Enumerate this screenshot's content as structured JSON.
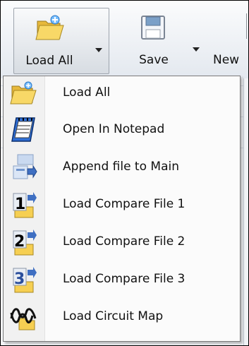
{
  "toolbar": {
    "load_all": {
      "label": "Load All",
      "icon": "folder-open-icon"
    },
    "save": {
      "label": "Save",
      "icon": "floppy-disk-icon"
    },
    "new": {
      "label": "New",
      "icon": "new-document-icon"
    }
  },
  "menu": {
    "items": [
      {
        "label": "Load All",
        "icon": "folder-open-icon"
      },
      {
        "label": "Open In Notepad",
        "icon": "notepad-icon"
      },
      {
        "label": "Append file to Main",
        "icon": "append-file-icon"
      },
      {
        "label": "Load Compare File 1",
        "icon": "compare-file-1-icon"
      },
      {
        "label": "Load Compare File 2",
        "icon": "compare-file-2-icon"
      },
      {
        "label": "Load Compare File 3",
        "icon": "compare-file-3-icon"
      },
      {
        "label": "Load Circuit Map",
        "icon": "circuit-map-icon"
      }
    ]
  },
  "colors": {
    "toolbar_bg": "#eef1f5",
    "menu_bg": "#fbfbfb",
    "menu_border": "#7a7a7a",
    "folder_yellow": "#f6cf52",
    "notepad_blue": "#2f6fd6"
  }
}
